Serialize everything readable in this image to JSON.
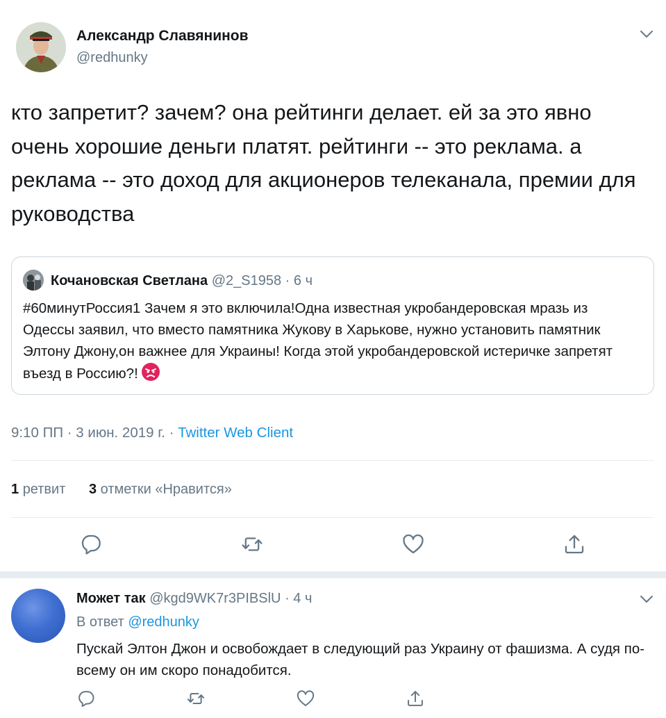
{
  "tweet": {
    "author_name": "Александр Славянинов",
    "author_handle": "@redhunky",
    "text": "кто запретит? зачем? она рейтинги делает. ей за это явно очень хорошие деньги платят. рейтинги -- это реклама. а реклама -- это доход для акционеров телеканала, премии для руководства",
    "quote": {
      "author_name": "Кочановская Светлана",
      "author_handle": "@2_S1958",
      "separator": "·",
      "time": "6 ч",
      "text": "#60минутРоссия1 Зачем я это включила!Одна известная укробандеровская мразь из Одессы заявил, что вместо памятника Жукову в Харькове, нужно установить памятник Элтону Джону,он важнее для Украины! Когда этой укробандеровской истеричке запретят въезд в Россию?!"
    },
    "timestamp": "9:10 ПП · 3 июн. 2019 г. · ",
    "client": "Twitter Web Client",
    "retweets_count": "1",
    "retweets_label": "ретвит",
    "likes_count": "3",
    "likes_label": "отметки «Нравится»"
  },
  "reply": {
    "author_name": "Может так",
    "author_handle": "@kgd9WK7r3PIBSlU",
    "separator": "·",
    "time": "4 ч",
    "in_reply_prefix": "В ответ",
    "in_reply_handle": "@redhunky",
    "text": "Пускай Элтон Джон и освобождает в следующий раз Украину от фашизма. А судя по-всему он им скоро понадобится."
  },
  "icons": {
    "menu": "chevron-down-icon",
    "reply": "reply-icon",
    "retweet": "retweet-icon",
    "like": "like-icon",
    "share": "share-icon",
    "emoji": "angry-face-emoji"
  },
  "colors": {
    "text": "#14171a",
    "secondary": "#657786",
    "link": "#1b95e0",
    "border": "#e6ecf0",
    "quote_border": "#ccd6dd",
    "emoji": "#e0245e"
  }
}
